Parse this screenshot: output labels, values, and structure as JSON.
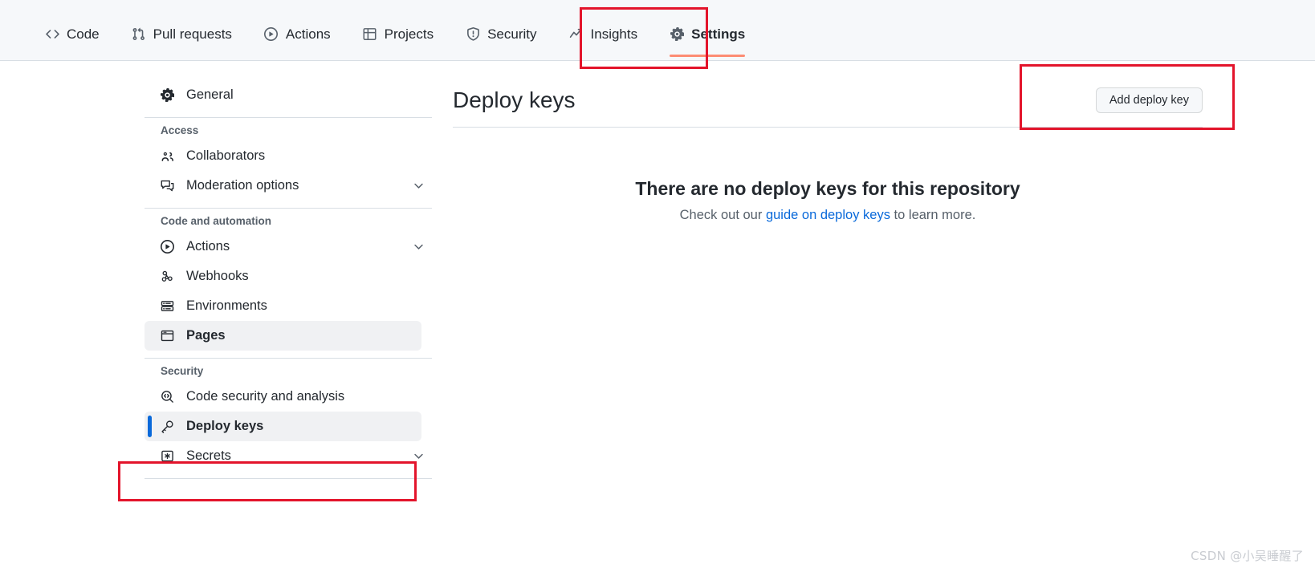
{
  "topnav": {
    "tabs": [
      {
        "label": "Code",
        "icon": "code-icon",
        "active": false
      },
      {
        "label": "Pull requests",
        "icon": "git-pull-request-icon",
        "active": false
      },
      {
        "label": "Actions",
        "icon": "play-circle-icon",
        "active": false
      },
      {
        "label": "Projects",
        "icon": "table-icon",
        "active": false
      },
      {
        "label": "Security",
        "icon": "shield-icon",
        "active": false
      },
      {
        "label": "Insights",
        "icon": "graph-icon",
        "active": false
      },
      {
        "label": "Settings",
        "icon": "gear-icon",
        "active": true
      }
    ]
  },
  "sidebar": {
    "general": {
      "label": "General",
      "icon": "gear-icon"
    },
    "sections": [
      {
        "heading": "Access",
        "items": [
          {
            "label": "Collaborators",
            "icon": "people-icon",
            "chevron": false,
            "selected": false
          },
          {
            "label": "Moderation options",
            "icon": "comment-discussion-icon",
            "chevron": true,
            "selected": false
          }
        ]
      },
      {
        "heading": "Code and automation",
        "items": [
          {
            "label": "Actions",
            "icon": "play-circle-icon",
            "chevron": true,
            "selected": false
          },
          {
            "label": "Webhooks",
            "icon": "webhook-icon",
            "chevron": false,
            "selected": false
          },
          {
            "label": "Environments",
            "icon": "server-icon",
            "chevron": false,
            "selected": false
          },
          {
            "label": "Pages",
            "icon": "browser-icon",
            "chevron": false,
            "selected": true
          }
        ]
      },
      {
        "heading": "Security",
        "items": [
          {
            "label": "Code security and analysis",
            "icon": "codescan-icon",
            "chevron": false,
            "selected": false
          },
          {
            "label": "Deploy keys",
            "icon": "key-icon",
            "chevron": false,
            "selected": true,
            "current": true
          },
          {
            "label": "Secrets",
            "icon": "asterisk-icon",
            "chevron": true,
            "selected": false
          }
        ]
      }
    ]
  },
  "main": {
    "title": "Deploy keys",
    "add_button": "Add deploy key",
    "empty_title": "There are no deploy keys for this repository",
    "empty_sub_before": "Check out our ",
    "empty_sub_link": "guide on deploy keys",
    "empty_sub_after": " to learn more."
  },
  "watermark": "CSDN @小吴睡醒了",
  "colors": {
    "accent_tab_underline": "#fd8c73",
    "selected_indicator": "#0969da",
    "link": "#0969da",
    "annotation": "#e3142b",
    "nav_background": "#f6f8fa",
    "selected_background": "#f0f1f3"
  }
}
